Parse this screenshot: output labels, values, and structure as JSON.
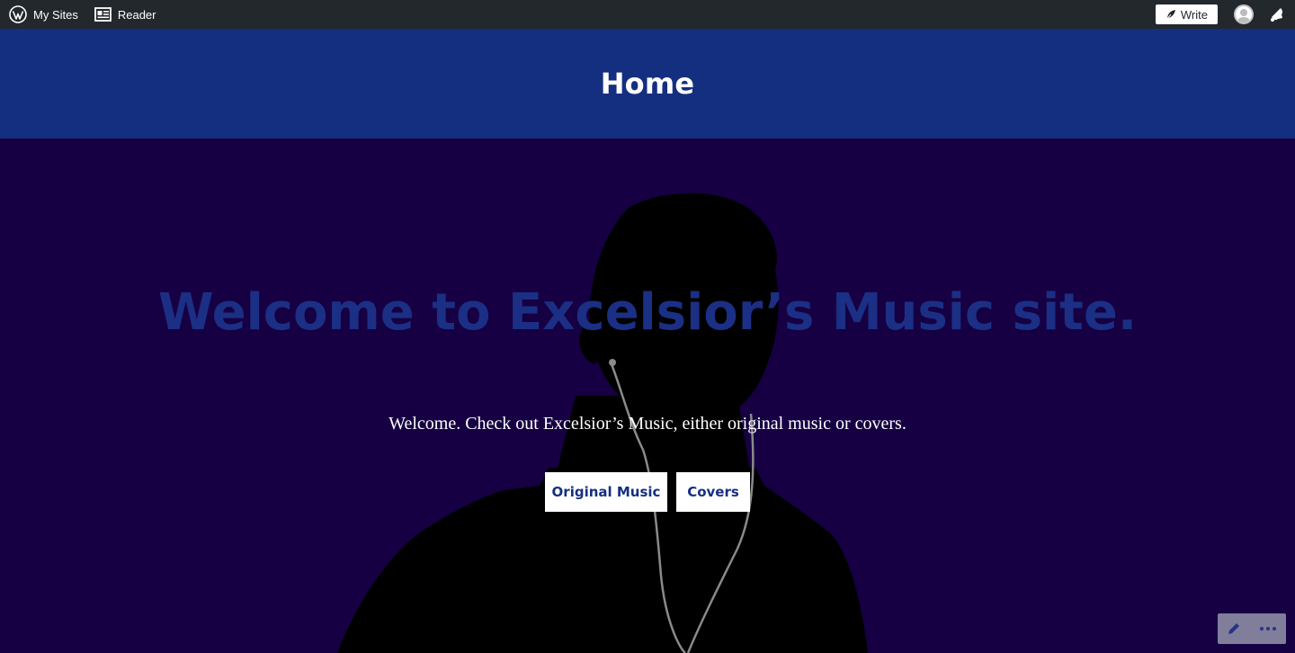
{
  "adminbar": {
    "my_sites_label": "My Sites",
    "reader_label": "Reader",
    "write_label": "Write",
    "icons": [
      "wordpress-icon",
      "reader-icon",
      "pen-icon",
      "avatar",
      "bell-icon"
    ]
  },
  "header": {
    "title": "Home"
  },
  "hero": {
    "title": "Welcome to Excelsior’s Music site.",
    "subtitle": "Welcome. Check out Excelsior’s Music, either original music or covers.",
    "buttons": [
      {
        "label": "Original Music"
      },
      {
        "label": "Covers"
      }
    ]
  },
  "floating_tools": {
    "icons": [
      "pencil-icon",
      "more-icon"
    ]
  },
  "colors": {
    "adminbar_bg": "#23282d",
    "header_bg": "#152f80",
    "hero_bg": "#160043",
    "hero_title": "#1b2f85"
  }
}
